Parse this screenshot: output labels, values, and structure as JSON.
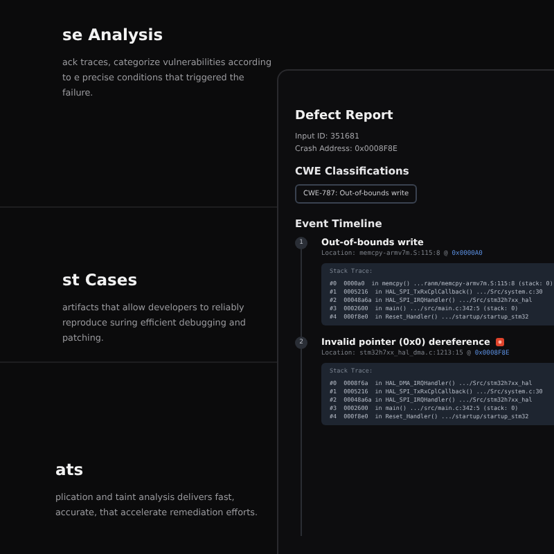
{
  "features": [
    {
      "title": "se Analysis",
      "body": "ack traces, categorize vulnerabilities according to e precise conditions that triggered the failure."
    },
    {
      "title": "st Cases",
      "body": "artifacts that allow developers to reliably reproduce suring efficient debugging and patching."
    },
    {
      "title": "ats",
      "body": "plication and taint analysis delivers fast, accurate, that accelerate remediation efforts."
    }
  ],
  "report": {
    "title": "Defect Report",
    "meta": [
      {
        "label": "Input ID:",
        "value": "351681"
      },
      {
        "label": "Crash Address:",
        "value": "0x0008F8E"
      }
    ],
    "cwe_heading": "CWE Classifications",
    "cwe_tags": [
      "CWE-787: Out-of-bounds write"
    ],
    "timeline_heading": "Event Timeline",
    "events": [
      {
        "number": "1",
        "title": "Out-of-bounds write",
        "flagged": false,
        "location": "Location: memcpy-armv7m.S:115:8 @",
        "address": "0x0000A0",
        "trace_title": "Stack Trace:",
        "frames": [
          "#0  0000a0  in memcpy() ...ranm/memcpy-armv7m.S:115:8 (stack: 0)",
          "#1  0005216  in HAL_SPI_TxRxCplCallback() .../Src/system.c:30",
          "#2  00048a6a in HAL_SPI_IRQHandler() .../Src/stm32h7xx_hal",
          "#3  0002600  in main() .../src/main.c:342:5 (stack: 0)",
          "#4  000f8e0  in Reset_Handler() .../startup/startup_stm32"
        ]
      },
      {
        "number": "2",
        "title": "Invalid pointer (0x0) dereference",
        "flagged": true,
        "location": "Location: stm32h7xx_hal_dma.c:1213:15 @",
        "address": "0x0008F8E",
        "trace_title": "Stack Trace:",
        "frames": [
          "#0  0008f6a  in HAL_DMA_IRQHandler() .../Src/stm32h7xx_hal",
          "#1  0005216  in HAL_SPI_TxRxCplCallback() .../Src/system.c:30",
          "#2  00048a6a in HAL_SPI_IRQHandler() .../Src/stm32h7xx_hal",
          "#3  0002600  in main() .../src/main.c:342:5 (stack: 0)",
          "#4  000f8e0  in Reset_Handler() .../startup/startup_stm32"
        ]
      }
    ]
  }
}
